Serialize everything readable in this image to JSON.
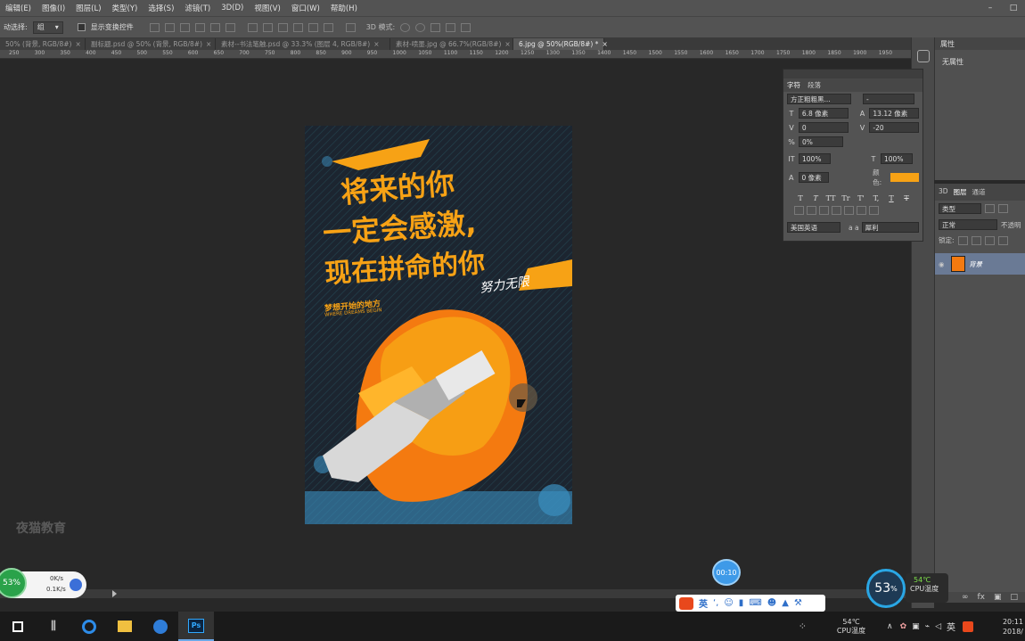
{
  "menubar": {
    "items": [
      "编辑(E)",
      "图像(I)",
      "图层(L)",
      "类型(Y)",
      "选择(S)",
      "滤镜(T)",
      "3D(D)",
      "视图(V)",
      "窗口(W)",
      "帮助(H)"
    ]
  },
  "options": {
    "auto_select_label": "动选择:",
    "auto_select_value": "组",
    "show_transform_label": "显示变换控件",
    "mode_3d_label": "3D 模式:"
  },
  "tabs": [
    {
      "label": "50% (背景, RGB/8#)"
    },
    {
      "label": "副标题.psd @ 50% (背景, RGB/8#)"
    },
    {
      "label": "素材--书法笔触.psd @ 33.3% (图层 4, RGB/8#)"
    },
    {
      "label": "素材-喷墨.jpg @ 66.7%(RGB/8#)"
    },
    {
      "label": "6.jpg @ 50%(RGB/8#) *"
    }
  ],
  "ruler": [
    "250",
    "300",
    "350",
    "400",
    "450",
    "500",
    "550",
    "600",
    "650",
    "700",
    "750",
    "800",
    "850",
    "900",
    "950",
    "1000",
    "1050",
    "1100",
    "1150",
    "1200",
    "1250",
    "1300",
    "1350",
    "1400",
    "1450",
    "1500",
    "1550",
    "1600",
    "1650",
    "1700",
    "1750",
    "1800",
    "1850",
    "1900",
    "1950"
  ],
  "poster": {
    "line1": "将来的你",
    "line2": "一定会感激,",
    "line3": "现在拼命的你",
    "signature": "努力无限",
    "sub_cn": "梦想开始的地方",
    "sub_en": "WHERE DREAMS BEGIN",
    "colors": {
      "bg": "#1c2530",
      "orange": "#f7a215",
      "deep_orange": "#f47a10"
    }
  },
  "watermark": "夜猫教育",
  "properties": {
    "title": "属性",
    "value": "无属性"
  },
  "character_panel": {
    "tab1": "字符",
    "tab2": "段落",
    "font_family": "方正粗粗黑...",
    "font_style": "-",
    "font_size": "6.8 像素",
    "leading": "13.12 像素",
    "kerning": "0",
    "tracking": "-20",
    "tsume": "0%",
    "vscale": "100%",
    "hscale": "100%",
    "baseline": "0 像素",
    "color_label": "颜色:",
    "color": "#f7a215",
    "language": "美国英语",
    "aa_label": "a a",
    "aa_value": "犀利",
    "style_glyphs": [
      "T",
      "T",
      "TT",
      "Tr",
      "T'",
      "T,",
      "T",
      "T"
    ]
  },
  "layers_panel": {
    "tabs": [
      "3D",
      "图层",
      "通道"
    ],
    "kind": "类型",
    "blend": "正常",
    "opacity_label": "不透明",
    "lock_label": "锁定:",
    "layer_name": "背景"
  },
  "network": {
    "percent": "53%",
    "up": "0K/s",
    "down": "0.1K/s"
  },
  "timer": "00:10",
  "ime": {
    "label": "英"
  },
  "cpu": {
    "percent": "53",
    "percent_unit": "%",
    "temp": "54℃",
    "temp_label": "CPU温度"
  },
  "taskbar": {
    "tray_temp": "54℃",
    "tray_label": "CPU温度",
    "ime": "英",
    "time": "20:11",
    "date": "2018/"
  }
}
